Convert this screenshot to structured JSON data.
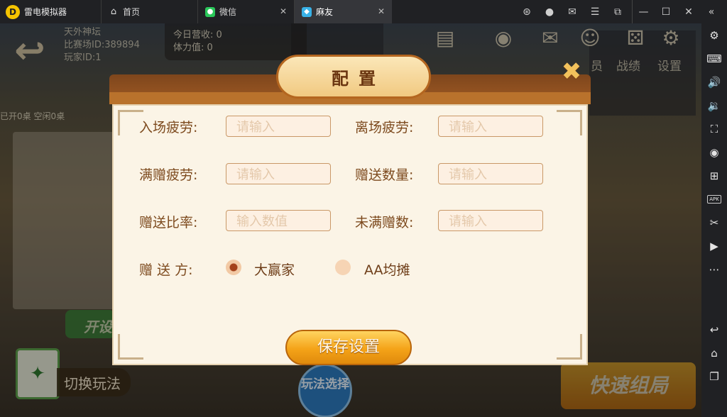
{
  "titlebar": {
    "app_name": "雷电模拟器",
    "tabs": [
      {
        "label": "首页",
        "icon": "home-icon"
      },
      {
        "label": "微信",
        "icon": "wechat-icon"
      },
      {
        "label": "麻友",
        "icon": "mahjong-app-icon",
        "active": true
      }
    ],
    "controls": [
      "gamepad-icon",
      "account-icon",
      "mail-icon",
      "menu-icon",
      "window-restore-icon",
      "minimize-icon",
      "maximize-icon",
      "close-icon",
      "collapse-sidebar-icon"
    ]
  },
  "sidebar": {
    "buttons": [
      "settings-icon",
      "keyboard-icon",
      "volume-up-icon",
      "volume-down-icon",
      "fullscreen-icon",
      "record-icon",
      "multi-instance-icon",
      "apk-install-icon",
      "scissors-icon",
      "video-icon",
      "more-icon",
      "back-icon",
      "home-icon",
      "recent-apps-icon"
    ],
    "apk_label": "APK"
  },
  "game": {
    "player": {
      "name": "天外神坛",
      "arena_id": "比赛场ID:389894",
      "player_id": "玩家ID:1"
    },
    "stats": {
      "today_revenue": "今日营收: 0",
      "stamina": "体力值: 0"
    },
    "top_menu": [
      {
        "label": "员",
        "icon": "member-icon"
      },
      {
        "label": "战绩",
        "icon": "record-dice-icon"
      },
      {
        "label": "设置",
        "icon": "gear-icon"
      }
    ],
    "table_counts": "已开0桌  空闲0桌",
    "open_table_label": "开设",
    "switch_mode_label": "切换玩法",
    "mode_select_label": "玩法选择",
    "quick_match_label": "快速组局"
  },
  "dialog": {
    "title": "配置",
    "fields": [
      {
        "label": "入场疲劳:",
        "placeholder": "请输入"
      },
      {
        "label": "离场疲劳:",
        "placeholder": "请输入"
      },
      {
        "label": "满赠疲劳:",
        "placeholder": "请输入"
      },
      {
        "label": "赠送数量:",
        "placeholder": "请输入"
      },
      {
        "label": "赠送比率:",
        "placeholder": "输入数值"
      },
      {
        "label": "未满赠数:",
        "placeholder": "请输入"
      }
    ],
    "gift_from": {
      "label": "赠 送 方:",
      "options": [
        {
          "label": "大赢家",
          "selected": true
        },
        {
          "label": "AA均摊",
          "selected": false
        }
      ]
    },
    "save_label": "保存设置"
  }
}
